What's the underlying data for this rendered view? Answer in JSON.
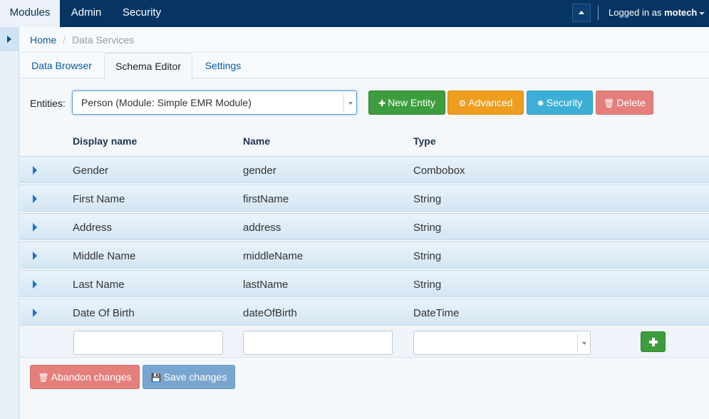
{
  "topnav": {
    "items": [
      {
        "label": "Modules",
        "active": true
      },
      {
        "label": "Admin",
        "active": false
      },
      {
        "label": "Security",
        "active": false
      }
    ],
    "logged_in_prefix": "Logged in as",
    "username": "motech"
  },
  "breadcrumb": {
    "home": "Home",
    "separator": "/",
    "current": "Data Services"
  },
  "tabs": [
    {
      "label": "Data Browser",
      "active": false
    },
    {
      "label": "Schema Editor",
      "active": true
    },
    {
      "label": "Settings",
      "active": false
    }
  ],
  "entities": {
    "label": "Entities:",
    "selected": "Person (Module: Simple EMR Module)"
  },
  "toolbar": {
    "new_entity": "New Entity",
    "advanced": "Advanced",
    "security": "Security",
    "delete": "Delete"
  },
  "table": {
    "headers": [
      "Display name",
      "Name",
      "Type"
    ],
    "rows": [
      {
        "display_name": "Gender",
        "name": "gender",
        "type": "Combobox"
      },
      {
        "display_name": "First Name",
        "name": "firstName",
        "type": "String"
      },
      {
        "display_name": "Address",
        "name": "address",
        "type": "String"
      },
      {
        "display_name": "Middle Name",
        "name": "middleName",
        "type": "String"
      },
      {
        "display_name": "Last Name",
        "name": "lastName",
        "type": "String"
      },
      {
        "display_name": "Date Of Birth",
        "name": "dateOfBirth",
        "type": "DateTime"
      }
    ],
    "new_field": {
      "display_name": "",
      "name": "",
      "type": ""
    }
  },
  "footer": {
    "abandon": "Abandon changes",
    "save": "Save changes"
  },
  "colors": {
    "navbar": "#063563",
    "success": "#3d9c3d",
    "warning": "#ef9d1f",
    "info": "#3dafd7",
    "danger": "#e47f7c",
    "primary_disabled": "#79a6d0"
  },
  "icons": {
    "collapse": "caret-up-icon",
    "sidebar_toggle": "caret-right-icon",
    "new_entity": "plus-icon",
    "advanced": "cogs-icon",
    "security": "gear-icon",
    "delete": "trash-icon",
    "abandon": "trash-icon",
    "save": "floppy-disk-icon",
    "row_expand": "caret-right-icon",
    "add_field": "plus-icon"
  }
}
